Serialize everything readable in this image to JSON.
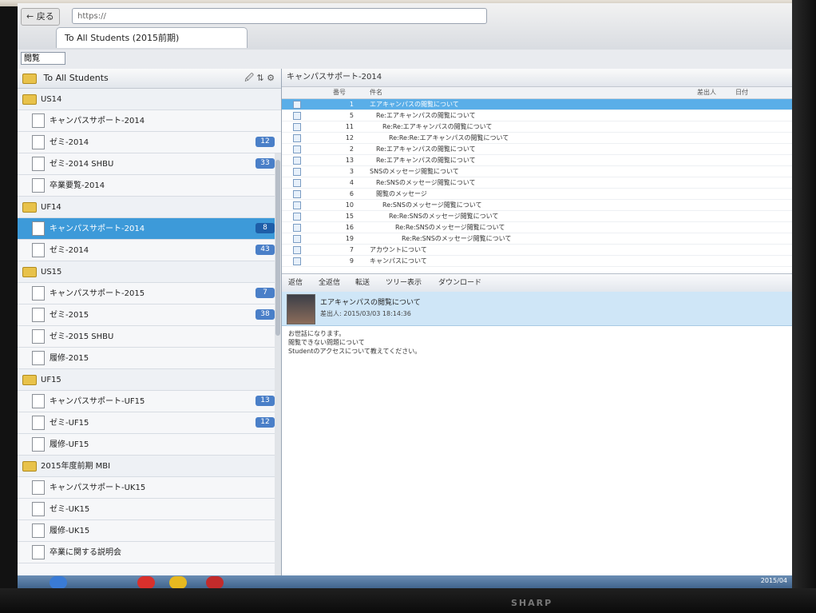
{
  "browser": {
    "back_label": "← 戻る",
    "forward_label": "→",
    "address": "https://",
    "tab_title": "To All Students (2015前期)"
  },
  "toolbar": {
    "dropdown_value": "閲覧"
  },
  "sidebar": {
    "header": "To All Students",
    "icons": "🖉 ⇅ ⚙",
    "rows": [
      {
        "type": "folder",
        "label": "US14"
      },
      {
        "type": "item",
        "label": "キャンパスサポート-2014",
        "badge": ""
      },
      {
        "type": "item",
        "label": "ゼミ-2014",
        "badge": "12"
      },
      {
        "type": "item",
        "label": "ゼミ-2014 SHBU",
        "badge": "33"
      },
      {
        "type": "item",
        "label": "卒業要覧-2014",
        "badge": ""
      },
      {
        "type": "folder",
        "label": "UF14"
      },
      {
        "type": "item",
        "label": "キャンパスサポート-2014",
        "badge": "8",
        "selected": true
      },
      {
        "type": "item",
        "label": "ゼミ-2014",
        "badge": "43"
      },
      {
        "type": "folder",
        "label": "US15"
      },
      {
        "type": "item",
        "label": "キャンパスサポート-2015",
        "badge": "7"
      },
      {
        "type": "item",
        "label": "ゼミ-2015",
        "badge": "38"
      },
      {
        "type": "item",
        "label": "ゼミ-2015 SHBU",
        "badge": ""
      },
      {
        "type": "item",
        "label": "履修-2015",
        "badge": ""
      },
      {
        "type": "folder",
        "label": "UF15"
      },
      {
        "type": "item",
        "label": "キャンパスサポート-UF15",
        "badge": "13"
      },
      {
        "type": "item",
        "label": "ゼミ-UF15",
        "badge": "12"
      },
      {
        "type": "item",
        "label": "履修-UF15",
        "badge": ""
      },
      {
        "type": "folder",
        "label": "2015年度前期 MBI"
      },
      {
        "type": "item",
        "label": "キャンパスサポート-UK15",
        "badge": ""
      },
      {
        "type": "item",
        "label": "ゼミ-UK15",
        "badge": ""
      },
      {
        "type": "item",
        "label": "履修-UK15",
        "badge": ""
      },
      {
        "type": "item",
        "label": "卒業に関する説明会",
        "badge": ""
      }
    ]
  },
  "thread": {
    "header": "キャンパスサポート-2014",
    "columns": {
      "num": "番号",
      "title": "件名",
      "author": "差出人",
      "date": "日付"
    },
    "rows": [
      {
        "num": "1",
        "title": "エアキャンパスの閲覧について",
        "author": "",
        "date": "",
        "indent": 0,
        "highlight": true
      },
      {
        "num": "5",
        "title": "Re:エアキャンパスの閲覧について",
        "author": "",
        "date": "",
        "indent": 1
      },
      {
        "num": "11",
        "title": "Re:Re:エアキャンパスの閲覧について",
        "author": "",
        "date": "",
        "indent": 2
      },
      {
        "num": "12",
        "title": "Re:Re:Re:エアキャンパスの閲覧について",
        "author": "",
        "date": "",
        "indent": 3
      },
      {
        "num": "2",
        "title": "Re:エアキャンパスの閲覧について",
        "author": "",
        "date": "",
        "indent": 1
      },
      {
        "num": "13",
        "title": "Re:エアキャンパスの閲覧について",
        "author": "",
        "date": "",
        "indent": 1
      },
      {
        "num": "3",
        "title": "SNSのメッセージ閲覧について",
        "author": "",
        "date": "",
        "indent": 0
      },
      {
        "num": "4",
        "title": "Re:SNSのメッセージ閲覧について",
        "author": "",
        "date": "",
        "indent": 1
      },
      {
        "num": "6",
        "title": "閲覧のメッセージ",
        "author": "",
        "date": "",
        "indent": 1
      },
      {
        "num": "10",
        "title": "Re:SNSのメッセージ閲覧について",
        "author": "",
        "date": "",
        "indent": 2
      },
      {
        "num": "15",
        "title": "Re:Re:SNSのメッセージ閲覧について",
        "author": "",
        "date": "",
        "indent": 3
      },
      {
        "num": "16",
        "title": "Re:Re:SNSのメッセージ閲覧について",
        "author": "",
        "date": "",
        "indent": 4
      },
      {
        "num": "19",
        "title": "Re:Re:SNSのメッセージ閲覧について",
        "author": "",
        "date": "",
        "indent": 5
      },
      {
        "num": "7",
        "title": "アカウントについて",
        "author": "",
        "date": "",
        "indent": 0
      },
      {
        "num": "9",
        "title": "キャンパスについて",
        "author": "",
        "date": "",
        "indent": 0
      }
    ]
  },
  "message": {
    "toolbar": [
      "返信",
      "全返信",
      "転送",
      "ツリー表示",
      "ダウンロード"
    ],
    "title": "エアキャンパスの閲覧について",
    "from": "差出人: 2015/03/03 18:14:36",
    "body": [
      "お世話になります。",
      "閲覧できない問題について",
      "Studentのアクセスについて教えてください。",
      ""
    ]
  },
  "taskbar": {
    "clock": "2015/04"
  },
  "monitor": {
    "brand": "SHARP"
  }
}
